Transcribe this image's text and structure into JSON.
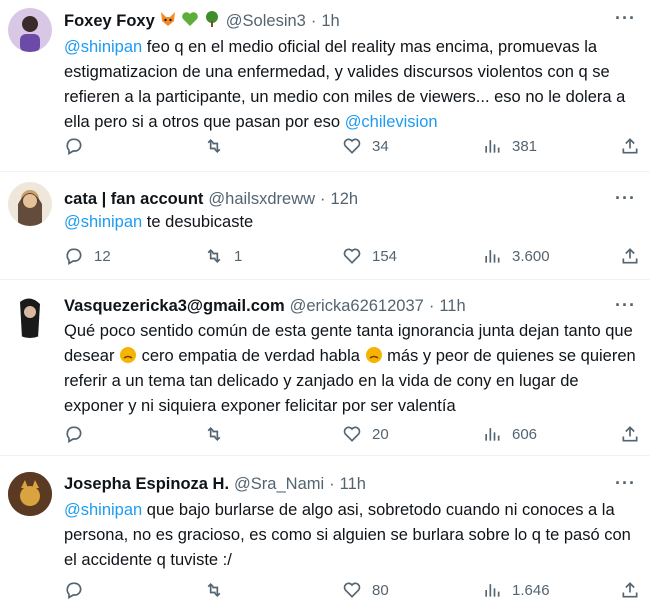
{
  "tweets": [
    {
      "name": "Foxey Foxy",
      "handle": "@Solesin3",
      "time": "1h",
      "mention1": "@shinipan",
      "text": " feo q en el medio oficial del reality mas encima, promuevas la estigmatizacion de una enfermedad, y valides discursos violentos con q se refieren a la participante, un medio con miles de viewers... eso no le dolera a ella pero si a otros que pasan por eso ",
      "mention2": "@chilevision",
      "replies": "",
      "retweets": "",
      "likes": "34",
      "views": "381"
    },
    {
      "name": "cata | fan account",
      "handle": "@hailsxdreww",
      "time": "12h",
      "mention1": "@shinipan",
      "text": " te desubicaste",
      "replies": "12",
      "retweets": "1",
      "likes": "154",
      "views": "3.600"
    },
    {
      "name": "Vasquezericka3@gmail.com",
      "handle": "@ericka62612037",
      "time": "11h",
      "text_a": "Qué poco sentido común de esta gente tanta ignorancia junta dejan tanto que desear ",
      "text_b": " cero empatia de verdad habla ",
      "text_c": " más y peor de quienes se quieren referir a un tema tan delicado y zanjado en la vida de cony en lugar de exponer y ni siquiera exponer felicitar por ser valentía",
      "replies": "",
      "retweets": "",
      "likes": "20",
      "views": "606"
    },
    {
      "name": "Josepha Espinoza H.",
      "handle": "@Sra_Nami",
      "time": "11h",
      "mention1": "@shinipan",
      "text": " que bajo burlarse de algo asi, sobretodo cuando ni conoces a la persona, no es gracioso, es como si alguien se burlara sobre lo q te pasó con el accidente q tuviste :/",
      "replies": "",
      "retweets": "",
      "likes": "80",
      "views": "1.646"
    }
  ],
  "dot": "·",
  "more_label": "···",
  "colors": {
    "accent": "#1d9bf0",
    "muted": "#536471",
    "text": "#0f1419"
  }
}
